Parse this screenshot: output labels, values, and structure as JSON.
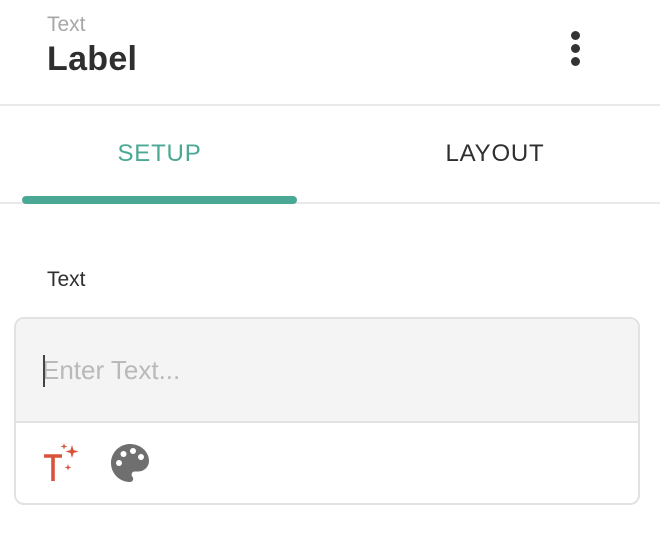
{
  "header": {
    "kind": "Text",
    "title": "Label",
    "menu_icon": "more-vertical-icon"
  },
  "tabs": [
    {
      "label": "SETUP",
      "active": true
    },
    {
      "label": "LAYOUT",
      "active": false
    }
  ],
  "colors": {
    "accent": "#4aa894",
    "magic_icon": "#d9533a",
    "palette_icon": "#6f6f6f"
  },
  "field": {
    "label": "Text",
    "value": "",
    "placeholder": "Enter Text..."
  },
  "toolbar": {
    "icons": [
      "magic-text-icon",
      "palette-icon"
    ]
  }
}
